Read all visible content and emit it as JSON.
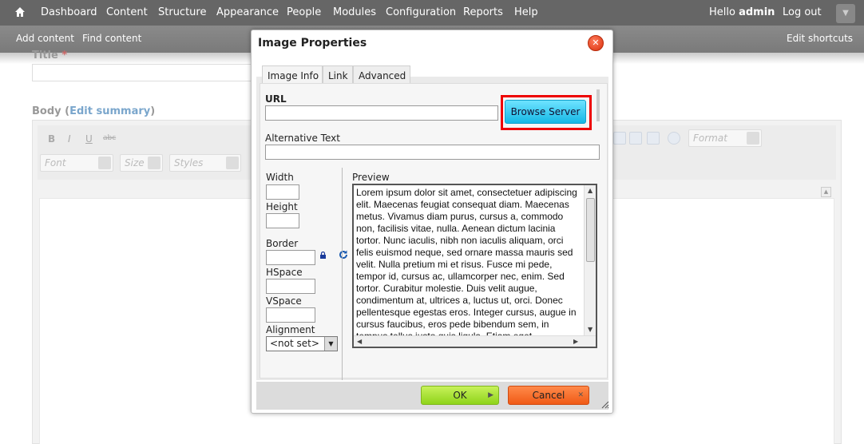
{
  "toolbar": {
    "menu": [
      "Dashboard",
      "Content",
      "Structure",
      "Appearance",
      "People",
      "Modules",
      "Configuration",
      "Reports",
      "Help"
    ],
    "hello": "Hello",
    "user": "admin",
    "logout": "Log out"
  },
  "shortcuts": {
    "add_content": "Add content",
    "find_content": "Find content",
    "edit_shortcuts": "Edit shortcuts"
  },
  "form": {
    "title_label": "Title",
    "required_mark": "*",
    "body_label": "Body",
    "edit_summary": "Edit summary",
    "body_paren_open": "(",
    "body_paren_close": ")",
    "combo_font": "Font",
    "combo_size": "Size",
    "combo_styles": "Styles",
    "combo_format": "Format",
    "toolbar_buttons": [
      "B",
      "I",
      "U",
      "abc"
    ]
  },
  "dialog": {
    "title": "Image Properties",
    "tabs": [
      "Image Info",
      "Link",
      "Advanced"
    ],
    "url_label": "URL",
    "url_value": "",
    "browse_button": "Browse Server",
    "alt_label": "Alternative Text",
    "alt_value": "",
    "width_label": "Width",
    "height_label": "Height",
    "border_label": "Border",
    "hspace_label": "HSpace",
    "vspace_label": "VSpace",
    "alignment_label": "Alignment",
    "alignment_value": "<not set>",
    "preview_label": "Preview",
    "preview_text": "Lorem ipsum dolor sit amet, consectetuer adipiscing elit. Maecenas feugiat consequat diam. Maecenas metus. Vivamus diam purus, cursus a, commodo non, facilisis vitae, nulla. Aenean dictum lacinia tortor. Nunc iaculis, nibh non iaculis aliquam, orci felis euismod neque, sed ornare massa mauris sed velit. Nulla pretium mi et risus. Fusce mi pede, tempor id, cursus ac, ullamcorper nec, enim. Sed tortor. Curabitur molestie. Duis velit augue, condimentum at, ultrices a, luctus ut, orci. Donec pellentesque egestas eros. Integer cursus, augue in cursus faucibus, eros pede bibendum sem, in tempus tellus justo quis ligula. Etiam eget",
    "ok_button": "OK",
    "cancel_button": "Cancel"
  },
  "colors": {
    "toolbar_bg": "#666666",
    "highlight": "#ee0000",
    "browse_btn": "#22bde8",
    "ok_btn": "#9ad922",
    "cancel_btn": "#f36a2a"
  }
}
